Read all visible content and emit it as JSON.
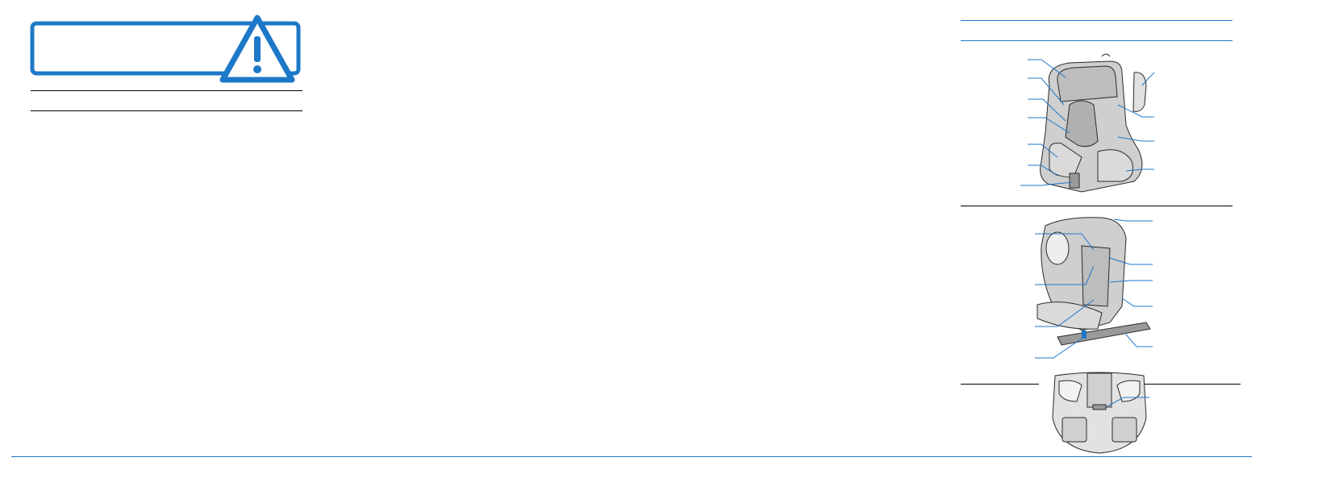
{
  "colors": {
    "accent": "#1e78c8",
    "rule": "#000000",
    "seat_fill": "#cfcfcf",
    "seat_dark": "#9a9a9a",
    "outline": "#2a2a2a"
  },
  "icons": {
    "warning": "warning-triangle-icon"
  }
}
